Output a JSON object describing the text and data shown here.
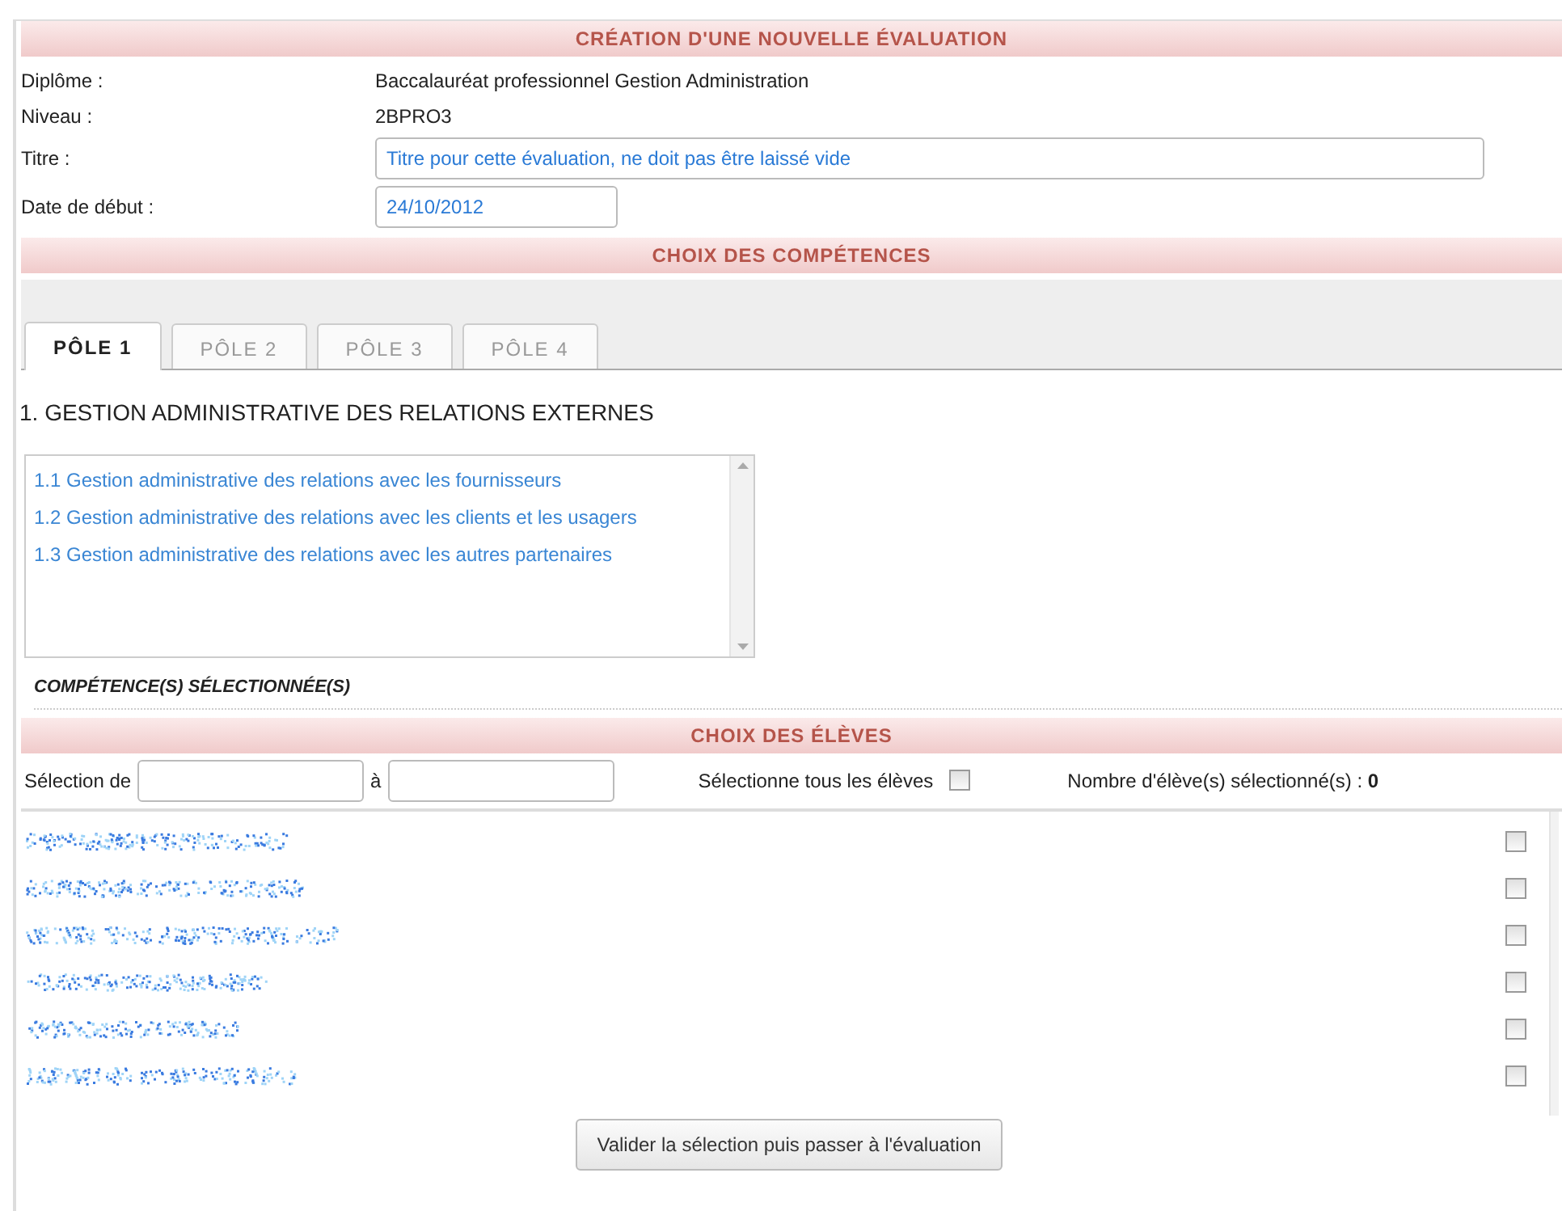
{
  "header_title": "CRÉATION D'UNE NOUVELLE ÉVALUATION",
  "fields": [
    {
      "kind": "text",
      "label": "Diplôme :",
      "value": "Baccalauréat professionnel Gestion Administration"
    },
    {
      "kind": "text",
      "label": "Niveau :",
      "value": "2BPRO3"
    },
    {
      "kind": "input",
      "label": "Titre :",
      "value": "Titre pour cette évaluation, ne doit pas être laissé vide"
    },
    {
      "kind": "date",
      "label": "Date de début :",
      "value": "24/10/2012"
    }
  ],
  "competences": {
    "title": "CHOIX DES COMPÉTENCES",
    "tabs": [
      {
        "label": "PÔLE 1",
        "selected": true
      },
      {
        "label": "PÔLE 2",
        "selected": false
      },
      {
        "label": "PÔLE 3",
        "selected": false
      },
      {
        "label": "PÔLE 4",
        "selected": false
      }
    ],
    "heading": "1. GESTION ADMINISTRATIVE DES RELATIONS EXTERNES",
    "items": [
      "1.1 Gestion administrative des relations avec les fournisseurs",
      "1.2 Gestion administrative des relations avec les clients et les usagers",
      "1.3 Gestion administrative des relations avec les autres partenaires"
    ],
    "selected_label": "COMPÉTENCE(S) SÉLECTIONNÉE(S)"
  },
  "eleves": {
    "title": "CHOIX DES ÉLÈVES",
    "from_label": "Sélection de",
    "to_label": "à",
    "select_all_label": "Sélectionne tous les élèves",
    "select_all_checked": false,
    "count_label": "Nombre d'élève(s) sélectionné(s) :",
    "count": "0",
    "students": [
      {
        "checked": false
      },
      {
        "checked": false
      },
      {
        "checked": false
      },
      {
        "checked": false
      },
      {
        "checked": false
      },
      {
        "checked": false
      }
    ]
  },
  "submit_button": "Valider la sélection puis passer à l'évaluation"
}
